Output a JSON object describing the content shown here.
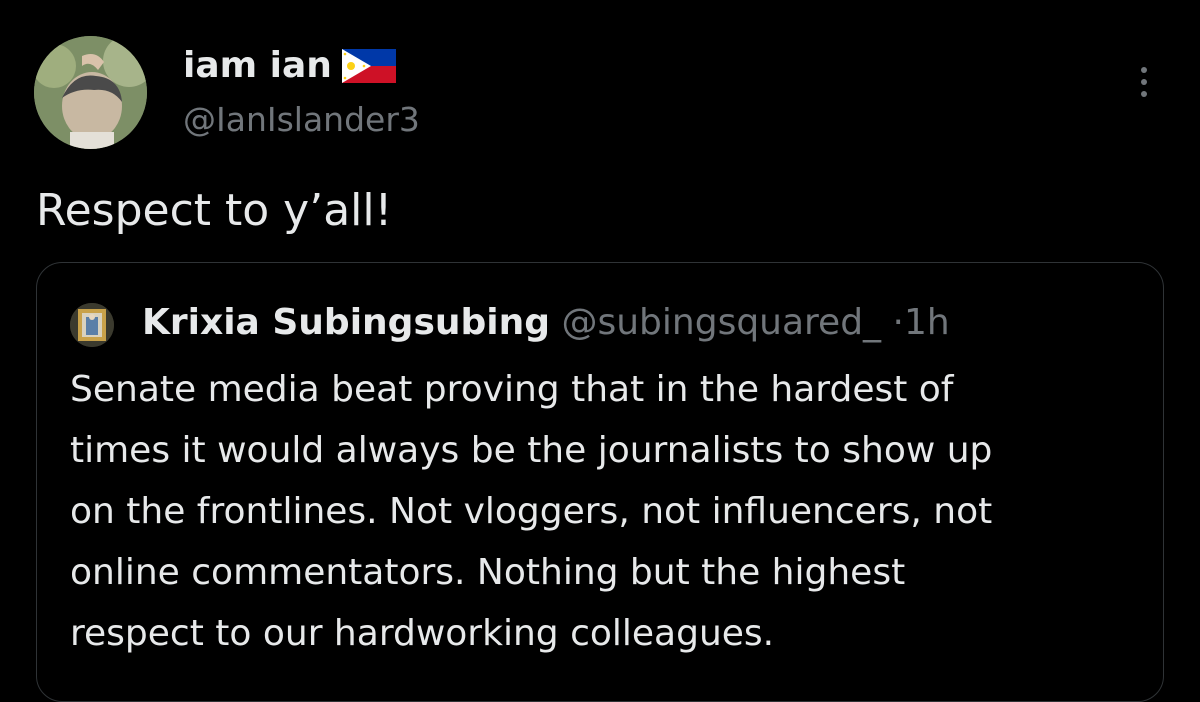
{
  "tweet": {
    "author": {
      "display_name": "iam ian",
      "handle": "@IanIslander3",
      "flag_icon": "philippines-flag-icon"
    },
    "text": "Respect to y’all!",
    "more_icon": "more-options-icon"
  },
  "quoted_tweet": {
    "author": {
      "display_name": "Krixia Subingsubing",
      "handle": "@subingsquared_"
    },
    "separator": "·",
    "time": "1h",
    "text_lines": [
      "Senate media beat proving that in the hardest of",
      "times it would always be the journalists to show up",
      "on the frontlines. Not vloggers, not influencers, not",
      "online commentators. Nothing but the highest",
      "respect to our hardworking colleagues."
    ]
  },
  "colors": {
    "background": "#000000",
    "primary_text": "#e7e9ea",
    "secondary_text": "#71767b",
    "border": "#2f3336"
  }
}
